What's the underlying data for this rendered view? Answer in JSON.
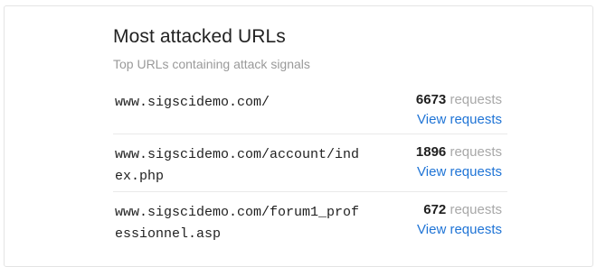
{
  "widget": {
    "title": "Most attacked URLs",
    "subtitle": "Top URLs containing attack signals"
  },
  "rows": [
    {
      "url": "www.sigscidemo.com/",
      "count": "6673",
      "unit": "requests",
      "link": "View requests"
    },
    {
      "url": "www.sigscidemo.com/account/index.php",
      "count": "1896",
      "unit": "requests",
      "link": "View requests"
    },
    {
      "url": "www.sigscidemo.com/forum1_professionnel.asp",
      "count": "672",
      "unit": "requests",
      "link": "View requests"
    }
  ],
  "colors": {
    "link": "#1f74d6",
    "muted": "#a8a8a8",
    "border": "#e4e4e4"
  }
}
